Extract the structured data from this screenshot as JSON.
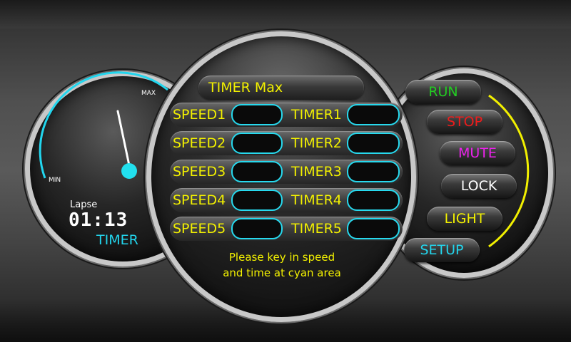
{
  "gauge": {
    "max_label": "MAX",
    "min_label": "MIN",
    "lapse_label": "Lapse",
    "lapse_time": "01:13",
    "timer_label": "TIMER",
    "needle_fraction": 0.4
  },
  "center": {
    "timer_max_label": "TIMER Max",
    "rows": [
      {
        "speed_label": "SPEED1",
        "speed_value": "",
        "timer_label": "TIMER1",
        "timer_value": ""
      },
      {
        "speed_label": "SPEED2",
        "speed_value": "",
        "timer_label": "TIMER2",
        "timer_value": ""
      },
      {
        "speed_label": "SPEED3",
        "speed_value": "",
        "timer_label": "TIMER3",
        "timer_value": ""
      },
      {
        "speed_label": "SPEED4",
        "speed_value": "",
        "timer_label": "TIMER4",
        "timer_value": ""
      },
      {
        "speed_label": "SPEED5",
        "speed_value": "",
        "timer_label": "TIMER5",
        "timer_value": ""
      }
    ],
    "hint_line1": "Please key in speed",
    "hint_line2": "and time at cyan area"
  },
  "controls": {
    "run": {
      "label": "RUN",
      "color": "#22cc22"
    },
    "stop": {
      "label": "STOP",
      "color": "#ee1c1c"
    },
    "mute": {
      "label": "MUTE",
      "color": "#ee22ee"
    },
    "lock": {
      "label": "LOCK",
      "color": "#ffffff"
    },
    "light": {
      "label": "LIGHT",
      "color": "#f2f000"
    },
    "setup": {
      "label": "SETUP",
      "color": "#22d6ee"
    }
  },
  "colors": {
    "accent_cyan": "#22d6ee",
    "label_yellow": "#f2f000"
  }
}
